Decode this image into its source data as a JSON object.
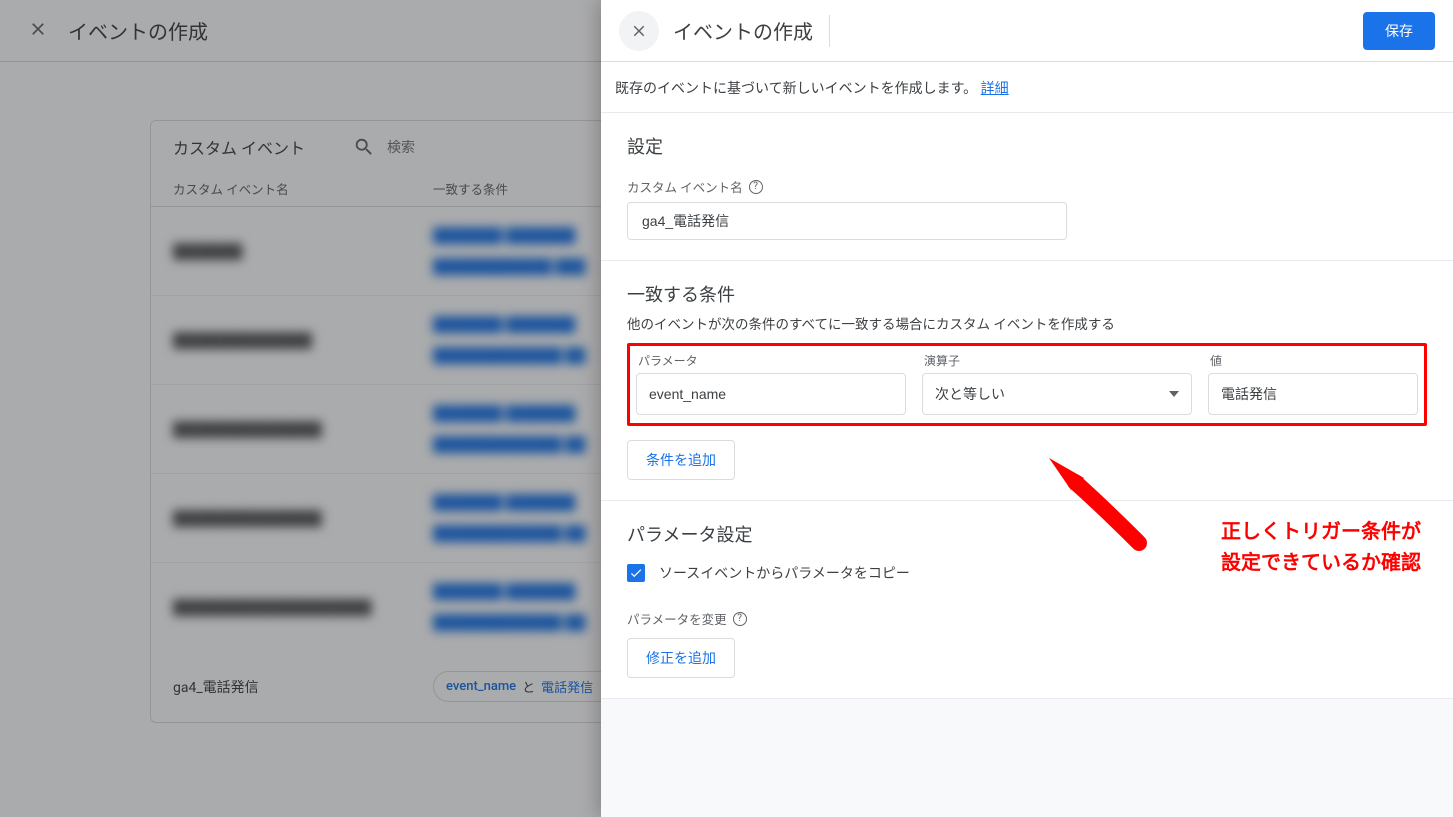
{
  "bg": {
    "title": "イベントの作成",
    "card_title": "カスタム イベント",
    "search_placeholder": "検索",
    "col_name": "カスタム イベント名",
    "col_cond": "一致する条件",
    "rows": [
      {
        "name": "███████",
        "conds": [
          "███████  ███████",
          "████████████  ███"
        ]
      },
      {
        "name": "██████████████",
        "conds": [
          "███████  ███████",
          "█████████████  ██"
        ]
      },
      {
        "name": "███████████████",
        "conds": [
          "███████  ███████",
          "█████████████  ██"
        ]
      },
      {
        "name": "███████████████",
        "conds": [
          "███████  ███████",
          "█████████████  ██"
        ]
      },
      {
        "name": "████████████████████",
        "conds": [
          "███████  ███████",
          "█████████████  ██"
        ]
      }
    ],
    "last_row": {
      "name": "ga4_電話発信",
      "chip_param": "event_name",
      "chip_conj": "と",
      "chip_value": "電話発信"
    }
  },
  "panel": {
    "title": "イベントの作成",
    "save": "保存",
    "intro_text": "既存のイベントに基づいて新しいイベントを作成します。",
    "intro_link": "詳細",
    "settings_title": "設定",
    "custom_name_label": "カスタム イベント名",
    "custom_name_value": "ga4_電話発信",
    "conditions_title": "一致する条件",
    "conditions_sub": "他のイベントが次の条件のすべてに一致する場合にカスタム イベントを作成する",
    "param_label": "パラメータ",
    "op_label": "演算子",
    "value_label": "値",
    "param_value": "event_name",
    "op_value": "次と等しい",
    "value_value": "電話発信",
    "add_condition": "条件を追加",
    "param_settings_title": "パラメータ設定",
    "copy_params_label": "ソースイベントからパラメータをコピー",
    "change_params_label": "パラメータを変更",
    "add_fix": "修正を追加"
  },
  "annotation": {
    "line1": "正しくトリガー条件が",
    "line2": "設定できているか確認"
  }
}
